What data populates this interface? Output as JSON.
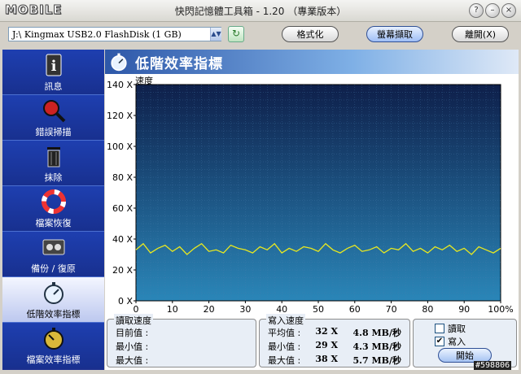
{
  "window": {
    "logo_text": "MOBILE",
    "title": "快閃記憶體工具箱 - 1.20 （專業版本）",
    "help_glyph": "?",
    "minimize_glyph": "–",
    "close_glyph": "×"
  },
  "toolbar": {
    "drive_value": "J:\\ Kingmax USB2.0 FlashDisk (1 GB)",
    "refresh_glyph": "↻",
    "format_label": "格式化",
    "capture_label": "螢幕擷取",
    "exit_label": "離開(X)"
  },
  "sidebar": {
    "items": [
      {
        "label": "訊息",
        "icon": "info-icon"
      },
      {
        "label": "錯誤掃描",
        "icon": "magnifier-icon"
      },
      {
        "label": "抹除",
        "icon": "trash-icon"
      },
      {
        "label": "檔案恢復",
        "icon": "lifebuoy-icon"
      },
      {
        "label": "備份 / 復原",
        "icon": "tape-icon"
      },
      {
        "label": "低階效率指標",
        "icon": "stopwatch-icon"
      },
      {
        "label": "檔案效率指標",
        "icon": "stopwatch-icon"
      }
    ],
    "active_index": 5
  },
  "main": {
    "title": "低階效率指標",
    "speed_label": "速度"
  },
  "chart_data": {
    "type": "line",
    "ylabel": "速度",
    "y_ticks": [
      "140 X",
      "120 X",
      "100 X",
      "80 X",
      "60 X",
      "40 X",
      "20 X",
      "0 X"
    ],
    "y_tick_values": [
      140,
      120,
      100,
      80,
      60,
      40,
      20,
      0
    ],
    "x_ticks": [
      "0",
      "10",
      "20",
      "30",
      "40",
      "50",
      "60",
      "70",
      "80",
      "90",
      "100%"
    ],
    "x_tick_values": [
      0,
      10,
      20,
      30,
      40,
      50,
      60,
      70,
      80,
      90,
      100
    ],
    "ylim": [
      0,
      140
    ],
    "xlim": [
      0,
      100
    ],
    "grid": true,
    "series": [
      {
        "color": "#e8e820",
        "x": [
          0,
          2,
          4,
          6,
          8,
          10,
          12,
          14,
          16,
          18,
          20,
          22,
          24,
          26,
          28,
          30,
          32,
          34,
          36,
          38,
          40,
          42,
          44,
          46,
          48,
          50,
          52,
          54,
          56,
          58,
          60,
          62,
          64,
          66,
          68,
          70,
          72,
          74,
          76,
          78,
          80,
          82,
          84,
          86,
          88,
          90,
          92,
          94,
          96,
          98,
          100
        ],
        "y": [
          33,
          37,
          31,
          34,
          36,
          32,
          35,
          30,
          34,
          37,
          32,
          33,
          31,
          36,
          34,
          33,
          31,
          35,
          33,
          37,
          31,
          34,
          32,
          35,
          34,
          32,
          37,
          33,
          31,
          34,
          36,
          32,
          33,
          35,
          31,
          34,
          33,
          37,
          32,
          34,
          31,
          35,
          33,
          36,
          32,
          34,
          30,
          35,
          33,
          31,
          34
        ]
      }
    ]
  },
  "read_panel": {
    "title": "讀取速度",
    "current_label": "目前值 :",
    "min_label": "最小值 :",
    "max_label": "最大值 :"
  },
  "write_panel": {
    "title": "寫入速度",
    "avg_label": "平均值 :",
    "avg_x": "32 X",
    "avg_mb": "4.8 MB/秒",
    "min_label": "最小值 :",
    "min_x": "29 X",
    "min_mb": "4.3 MB/秒",
    "max_label": "最大值 :",
    "max_x": "38 X",
    "max_mb": "5.7 MB/秒"
  },
  "options": {
    "read_label": "讀取",
    "read_checked": false,
    "write_label": "寫入",
    "write_checked": true,
    "check_glyph": "✔",
    "start_label": "開始"
  },
  "watermark": "#598806"
}
